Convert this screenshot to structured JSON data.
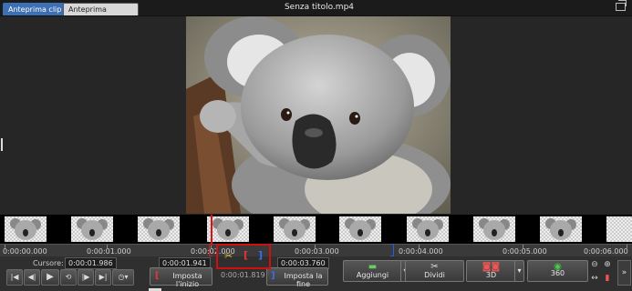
{
  "header": {
    "tabs": [
      {
        "label": "Anteprima clip",
        "active": true
      },
      {
        "label": "Anteprima sequenza",
        "active": false
      }
    ],
    "title": "Senza titolo.mp4"
  },
  "timeline": {
    "ruler_labels": [
      "0:00:00.000",
      "0:00:01.000",
      "0:00:02.000",
      "0:00:03.000",
      "0:00:04.000",
      "0:00:05.000",
      "0:00:06.000"
    ]
  },
  "controls": {
    "cursor_label": "Cursore:",
    "cursor_value": "0:00:01.986",
    "in_value": "0:00:01.941",
    "duration_value": "0:00:01.819",
    "out_value": "0:00:03.760",
    "set_in_label": "Imposta l'inizio",
    "set_out_label": "Imposta la fine",
    "add_label": "Aggiungi",
    "split_label": "Dividi",
    "threed_label": "3D",
    "threesixty_label": "360"
  },
  "colors": {
    "accent_tab": "#3d6fb4",
    "playhead": "#dd1111",
    "in_mark": "#cc2222",
    "out_mark": "#2b5fd6",
    "highlight_box": "#d01010"
  }
}
